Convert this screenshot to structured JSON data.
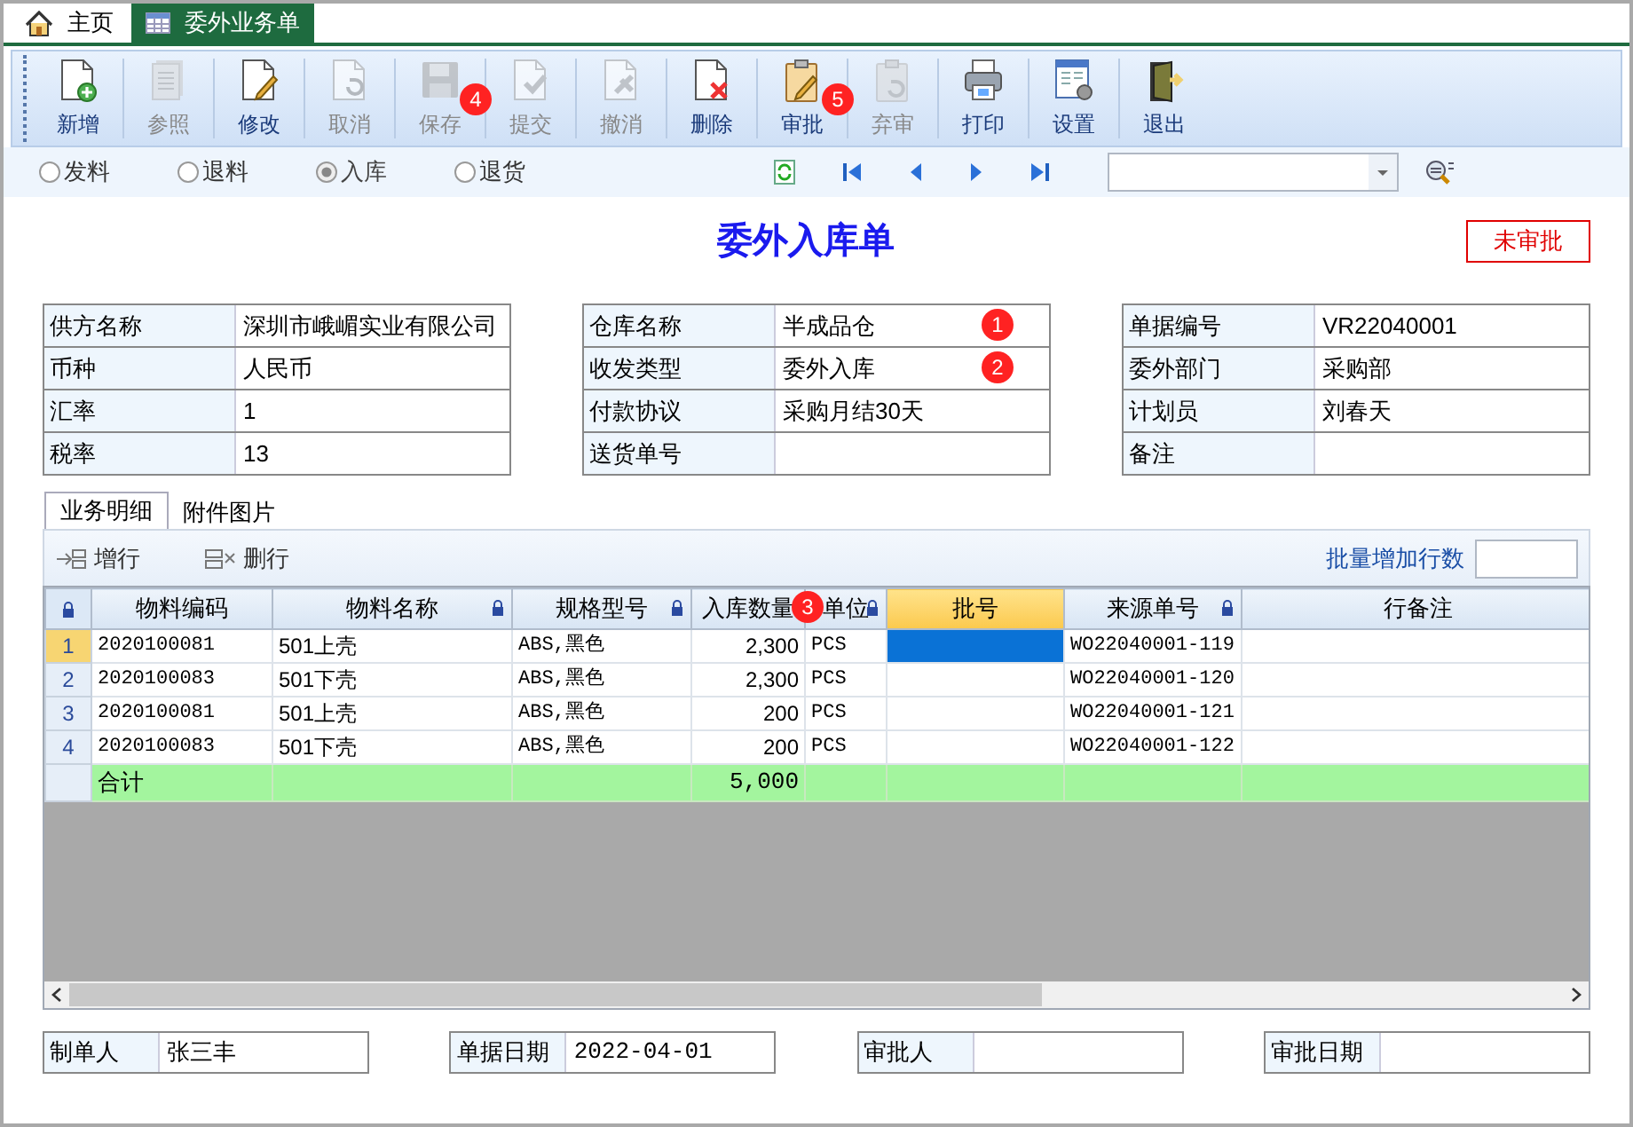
{
  "tabs": [
    {
      "label": "主页",
      "selected": false
    },
    {
      "label": "委外业务单",
      "selected": true
    }
  ],
  "toolbar": [
    {
      "label": "新增",
      "disabled": false
    },
    {
      "label": "参照",
      "disabled": true
    },
    {
      "label": "修改",
      "disabled": false
    },
    {
      "label": "取消",
      "disabled": true
    },
    {
      "label": "保存",
      "disabled": true,
      "badge": "4"
    },
    {
      "label": "提交",
      "disabled": true
    },
    {
      "label": "撤消",
      "disabled": true
    },
    {
      "label": "删除",
      "disabled": false
    },
    {
      "label": "审批",
      "disabled": false,
      "badge": "5"
    },
    {
      "label": "弃审",
      "disabled": true
    },
    {
      "label": "打印",
      "disabled": false
    },
    {
      "label": "设置",
      "disabled": false
    },
    {
      "label": "退出",
      "disabled": false
    }
  ],
  "radios": [
    {
      "label": "发料",
      "selected": false
    },
    {
      "label": "退料",
      "selected": false
    },
    {
      "label": "入库",
      "selected": true,
      "disabled": true
    },
    {
      "label": "退货",
      "selected": false
    }
  ],
  "form_title": "委外入库单",
  "status_stamp": "未审批",
  "info_groups": [
    [
      {
        "label": "供方名称",
        "value": "深圳市峨嵋实业有限公司"
      },
      {
        "label": "币种",
        "value": "人民币"
      },
      {
        "label": "汇率",
        "value": "1"
      },
      {
        "label": "税率",
        "value": "13"
      }
    ],
    [
      {
        "label": "仓库名称",
        "value": "半成品仓",
        "badge": "1"
      },
      {
        "label": "收发类型",
        "value": "委外入库",
        "badge": "2"
      },
      {
        "label": "付款协议",
        "value": "采购月结30天"
      },
      {
        "label": "送货单号"
      }
    ],
    [
      {
        "label": "单据编号",
        "value": "VR22040001"
      },
      {
        "label": "委外部门",
        "value": "采购部"
      },
      {
        "label": "计划员",
        "value": "刘春天"
      },
      {
        "label": "备注"
      }
    ]
  ],
  "detail_tabs": [
    {
      "label": "业务明细",
      "selected": true
    },
    {
      "label": "附件图片",
      "selected": false
    }
  ],
  "grid_actions": [
    {
      "label": "增行"
    },
    {
      "label": "删行"
    }
  ],
  "batch_add_label": "批量增加行数",
  "table": {
    "columns": [
      {
        "label": "物料编码",
        "locked": false,
        "selected": false
      },
      {
        "label": "物料名称",
        "locked": true,
        "selected": false
      },
      {
        "label": "规格型号",
        "locked": true,
        "selected": false
      },
      {
        "label": "入库数量",
        "locked": false,
        "selected": false,
        "badge": "3"
      },
      {
        "label": "单位",
        "locked": true,
        "selected": false
      },
      {
        "label": "批号",
        "locked": false,
        "selected": true
      },
      {
        "label": "来源单号",
        "locked": true,
        "selected": false
      },
      {
        "label": "行备注",
        "locked": false,
        "selected": false
      }
    ],
    "rows": [
      {
        "number": "1",
        "selected": true,
        "cells": [
          "2020100081",
          "501上壳",
          "ABS,黑色",
          "2,300",
          "PCS",
          "",
          "WO22040001-119",
          ""
        ]
      },
      {
        "number": "2",
        "selected": false,
        "cells": [
          "2020100083",
          "501下壳",
          "ABS,黑色",
          "2,300",
          "PCS",
          "",
          "WO22040001-120",
          ""
        ]
      },
      {
        "number": "3",
        "selected": false,
        "cells": [
          "2020100081",
          "501上壳",
          "ABS,黑色",
          "200",
          "PCS",
          "",
          "WO22040001-121",
          ""
        ]
      },
      {
        "number": "4",
        "selected": false,
        "cells": [
          "2020100083",
          "501下壳",
          "ABS,黑色",
          "200",
          "PCS",
          "",
          "WO22040001-122",
          ""
        ]
      }
    ],
    "total_row": {
      "label": "合计",
      "quantity": "5,000"
    }
  },
  "footer": [
    {
      "label": "制单人",
      "value": "张三丰"
    },
    {
      "label": "单据日期",
      "value": "2022-04-01"
    },
    {
      "label": "审批人"
    },
    {
      "label": "审批日期"
    }
  ]
}
